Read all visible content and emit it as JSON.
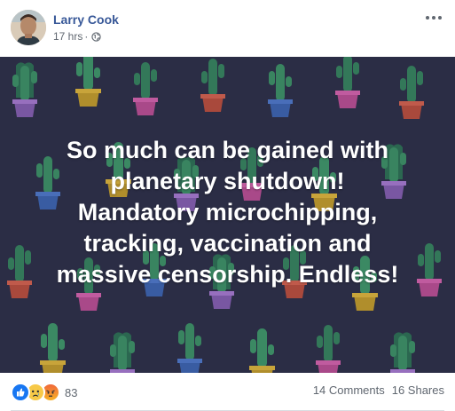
{
  "post": {
    "author": "Larry Cook",
    "time": "17 hrs",
    "separator": "·",
    "privacy_icon": "globe-icon",
    "more_icon": "more-options-icon"
  },
  "media": {
    "lines": [
      "So much can be gained with",
      "planetary shutdown!",
      "Mandatory microchipping,",
      "tracking, vaccination and",
      "massive censorship. Endless!"
    ],
    "background_color": "#2b2d45",
    "pattern": "cactus-pots"
  },
  "engagement": {
    "reaction_icons": [
      "like-icon",
      "sad-icon",
      "angry-icon"
    ],
    "reaction_count": "83",
    "comments": "14 Comments",
    "shares": "16 Shares"
  },
  "colors": {
    "author_link": "#385898",
    "meta_text": "#606770",
    "like_blue": "#1877f2"
  }
}
